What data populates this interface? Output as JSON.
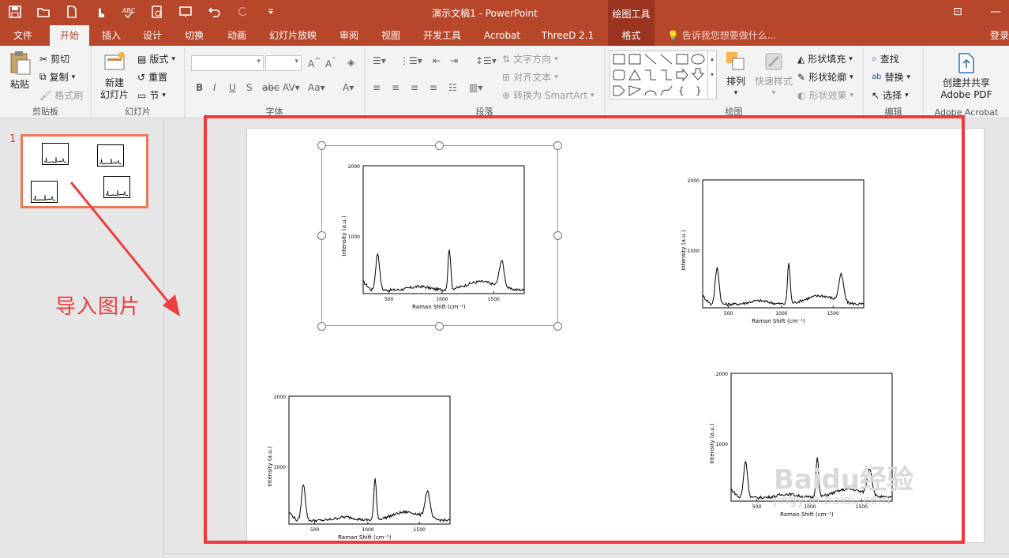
{
  "window": {
    "title": "演示文稿1 - PowerPoint",
    "context_tab_title": "绘图工具"
  },
  "tabs": [
    {
      "label": "文件"
    },
    {
      "label": "开始",
      "active": true
    },
    {
      "label": "插入"
    },
    {
      "label": "设计"
    },
    {
      "label": "切换"
    },
    {
      "label": "动画"
    },
    {
      "label": "幻灯片放映"
    },
    {
      "label": "审阅"
    },
    {
      "label": "视图"
    },
    {
      "label": "开发工具"
    },
    {
      "label": "Acrobat"
    },
    {
      "label": "ThreeD 2.1"
    },
    {
      "label": "格式",
      "context": true
    }
  ],
  "tell_me": "告诉我您想要做什么...",
  "sign_in": "登录",
  "ribbon": {
    "clipboard": {
      "label": "剪贴板",
      "paste": "粘贴",
      "cut": "剪切",
      "copy": "复制",
      "format_painter": "格式刷"
    },
    "slides": {
      "label": "幻灯片",
      "new_slide_line1": "新建",
      "new_slide_line2": "幻灯片",
      "layout": "版式",
      "reset": "重置",
      "section": "节"
    },
    "font": {
      "label": "字体"
    },
    "paragraph": {
      "label": "段落",
      "text_direction": "文字方向",
      "align_text": "对齐文本",
      "smartart": "转换为 SmartArt"
    },
    "drawing": {
      "label": "绘图",
      "arrange": "排列",
      "quick_styles": "快速样式",
      "shape_fill": "形状填充",
      "shape_outline": "形状轮廓",
      "shape_effects": "形状效果"
    },
    "editing": {
      "label": "编辑",
      "find": "查找",
      "replace": "替换",
      "select": "选择"
    },
    "acrobat": {
      "label": "Adobe Acrobat",
      "create_line1": "创建并共享",
      "create_line2": "Adobe PDF"
    }
  },
  "thumbnail": {
    "number": "1"
  },
  "annotation": "导入图片",
  "colors": {
    "accent": "#b7472a",
    "annotation_red": "#f0393e",
    "thumb_border": "#ee7756"
  },
  "charts": [
    {
      "x_label": "Raman Shift (cm⁻¹)",
      "y_label": "Intensity (a.u.)",
      "y_ticks": [
        "2000",
        "1000"
      ],
      "x_ticks": [
        "500",
        "1000",
        "1500"
      ]
    },
    {
      "x_label": "Raman Shift (cm⁻¹)",
      "y_label": "Intensity (a.u.)",
      "y_ticks": [
        "2000",
        "1000"
      ],
      "x_ticks": [
        "500",
        "1000",
        "1500"
      ]
    },
    {
      "x_label": "Raman Shift (cm⁻¹)",
      "y_label": "Intensity (a.u.)",
      "y_ticks": [
        "2000",
        "1000"
      ],
      "x_ticks": [
        "500",
        "1000",
        "1500"
      ]
    },
    {
      "x_label": "Raman Shift (cm⁻¹)",
      "y_label": "Intensity (a.u.)",
      "y_ticks": [
        "2000",
        "1000"
      ],
      "x_ticks": [
        "500",
        "1000",
        "1500"
      ]
    }
  ],
  "watermark": {
    "text": "Baidu经验",
    "url": "jingyan.baidu.com"
  }
}
